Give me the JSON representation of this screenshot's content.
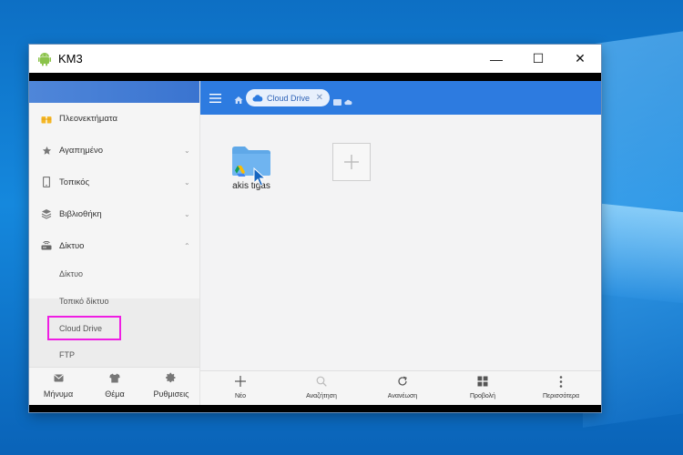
{
  "colors": {
    "accent": "#2d7be0",
    "highlight": "#ef1ee3",
    "folder": "#5fa8e8",
    "android": "#8bc34a"
  },
  "window": {
    "title": "KM3",
    "controls": {
      "minimize": "—",
      "maximize": "☐",
      "close": "✕"
    }
  },
  "sidebar": {
    "items": [
      {
        "label": "Πλεονεκτήματα",
        "icon": "gift-icon"
      },
      {
        "label": "Αγαπημένο",
        "icon": "star-icon",
        "expanded": false
      },
      {
        "label": "Τοπικός",
        "icon": "phone-icon",
        "expanded": false
      },
      {
        "label": "Βιβλιοθήκη",
        "icon": "layers-icon",
        "expanded": false
      },
      {
        "label": "Δίκτυο",
        "icon": "router-icon",
        "expanded": true
      }
    ],
    "subitems": [
      {
        "label": "Δίκτυο"
      },
      {
        "label": "Τοπικό δίκτυο"
      },
      {
        "label": "Cloud Drive",
        "selected": true
      },
      {
        "label": "FTP"
      }
    ],
    "bottom": [
      {
        "label": "Μήνυμα",
        "icon": "mail-icon"
      },
      {
        "label": "Θέμα",
        "icon": "shirt-icon"
      },
      {
        "label": "Ρυθμισεις",
        "icon": "gear-icon"
      }
    ]
  },
  "toolbar": {
    "path": {
      "label": "Cloud Drive",
      "close": "✕"
    }
  },
  "content": {
    "folders": [
      {
        "name": "akis tigas",
        "icon": "google-drive-folder-icon"
      }
    ],
    "add_tile": "+"
  },
  "bottombar": [
    {
      "label": "Νέο",
      "icon": "plus-icon"
    },
    {
      "label": "Αναζήτηση",
      "icon": "search-icon"
    },
    {
      "label": "Ανανέωση",
      "icon": "refresh-icon"
    },
    {
      "label": "Προβολή",
      "icon": "grid-icon"
    },
    {
      "label": "Περισσότερα",
      "icon": "more-vertical-icon"
    }
  ]
}
